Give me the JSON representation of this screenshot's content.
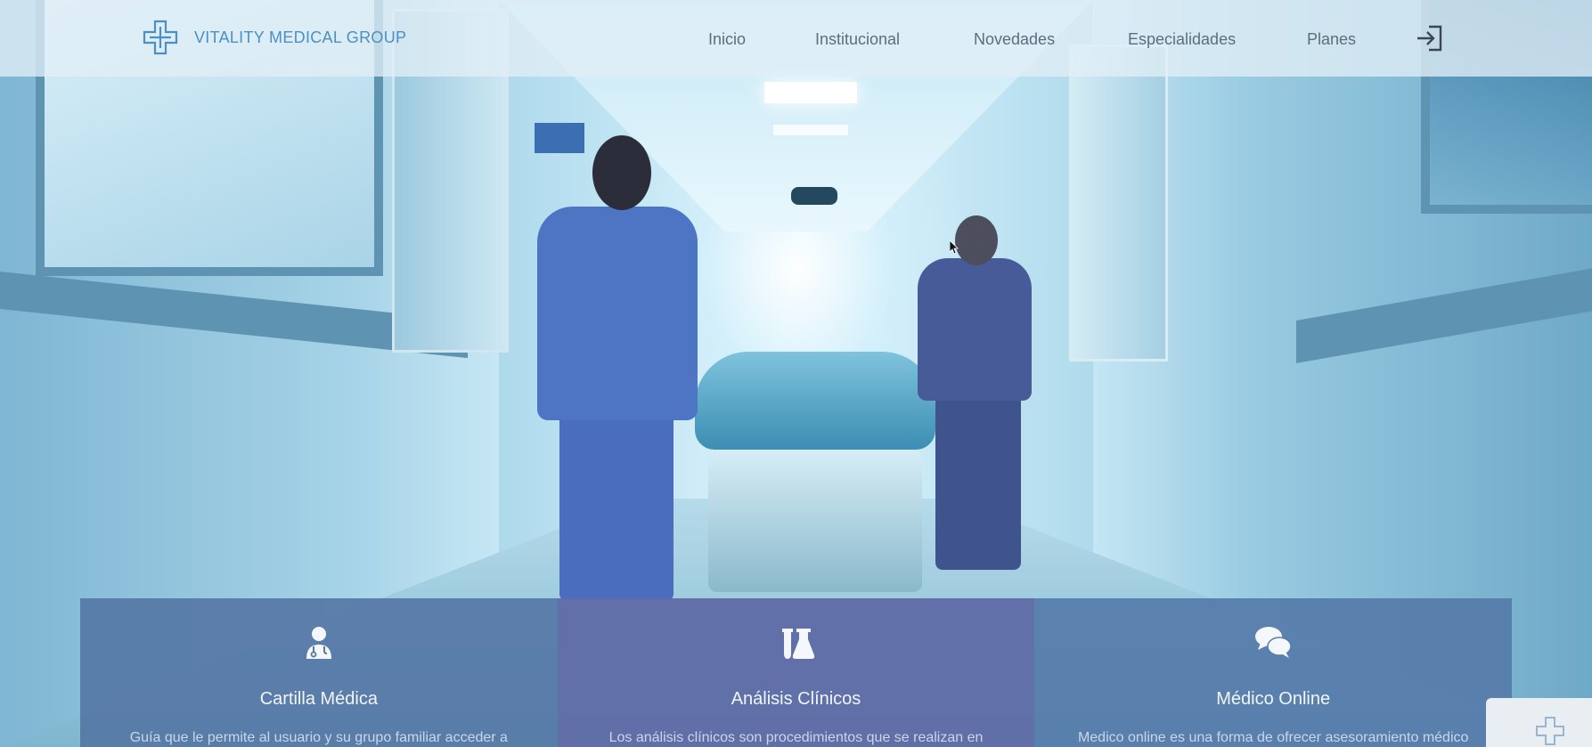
{
  "brand": {
    "name": "VITALITY MEDICAL GROUP",
    "icon": "medical-cross-logo-icon",
    "color": "#4a8fc6"
  },
  "nav": {
    "links": [
      {
        "label": "Inicio"
      },
      {
        "label": "Institucional"
      },
      {
        "label": "Novedades"
      },
      {
        "label": "Especialidades"
      },
      {
        "label": "Planes"
      }
    ],
    "login_icon": "login-icon"
  },
  "hero": {
    "image": "hospital-corridor-photo"
  },
  "cards": [
    {
      "icon": "doctor-icon",
      "title": "Cartilla Médica",
      "text": "Guía que le permite al usuario y su grupo familiar acceder a"
    },
    {
      "icon": "lab-flasks-icon",
      "title": "Análisis Clínicos",
      "text": "Los análisis clínicos son procedimientos que se realizan en"
    },
    {
      "icon": "chat-bubbles-icon",
      "title": "Médico Online",
      "text": "Medico online es una forma de ofrecer asesoramiento médico"
    }
  ],
  "widgets": {
    "chat": "chat-widget-icon"
  }
}
